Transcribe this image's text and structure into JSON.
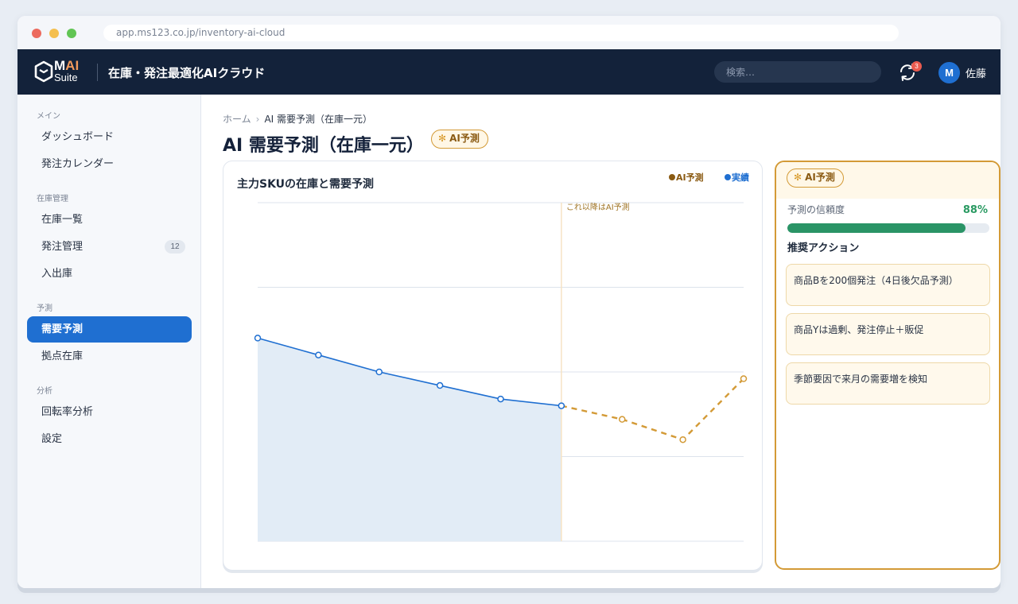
{
  "browser": {
    "url": "app.ms123.co.jp/inventory-ai-cloud"
  },
  "header": {
    "logo_ai": "AI",
    "logo_m": "M",
    "logo_suite": "Suite",
    "app_title": "在庫・発注最適化AIクラウド",
    "search_placeholder": "検索…",
    "notification_count": "3",
    "user_initial": "M",
    "user_name": "佐藤"
  },
  "sidebar": {
    "sections": [
      {
        "label": "メイン"
      },
      {
        "label": "在庫管理"
      },
      {
        "label": "予測"
      },
      {
        "label": "分析"
      }
    ],
    "items": [
      {
        "label": "ダッシュボード"
      },
      {
        "label": "発注カレンダー"
      },
      {
        "label": "在庫一覧"
      },
      {
        "label": "発注管理",
        "badge": "12"
      },
      {
        "label": "入出庫"
      },
      {
        "label": "需要予測",
        "active": true
      },
      {
        "label": "拠点在庫"
      },
      {
        "label": "回転率分析"
      },
      {
        "label": "設定"
      }
    ]
  },
  "breadcrumb": {
    "home": "ホーム",
    "separator": "›",
    "current": "AI 需要予測（在庫一元）"
  },
  "page": {
    "title": "AI 需要予測（在庫一元）",
    "ai_badge": "AI予測"
  },
  "chart_data": {
    "type": "line",
    "title": "主力SKUの在庫と需要予測",
    "x": [
      0,
      1,
      2,
      3,
      4,
      5,
      6,
      7,
      8
    ],
    "ylim": [
      0,
      100
    ],
    "grid": true,
    "legend_placement": "top-right",
    "annotation": "これ以降はAI予測",
    "forecast_start_index": 5,
    "series": [
      {
        "name": "実績",
        "color": "#1f6fd1",
        "values": [
          60,
          55,
          50,
          46,
          42,
          40,
          null,
          null,
          null
        ]
      },
      {
        "name": "AI予測",
        "color": "#d39a36",
        "values": [
          null,
          null,
          null,
          null,
          null,
          40,
          36,
          30,
          48
        ]
      }
    ]
  },
  "legend": {
    "ai": "AI予測",
    "actual": "実績"
  },
  "insight": {
    "badge": "AI予測",
    "confidence_label": "予測の信頼度",
    "confidence_value": "88%",
    "confidence_fraction": 0.88,
    "actions_title": "推奨アクション",
    "actions": [
      {
        "text": "商品Bを200個発注（4日後欠品予測）"
      },
      {
        "text": "商品Yは過剰、発注停止＋販促"
      },
      {
        "text": "季節要因で来月の需要増を検知"
      }
    ]
  },
  "colors": {
    "primary": "#1f6fd1",
    "ai_gold": "#d39a36",
    "topbar": "#13223a",
    "success": "#2a9466"
  }
}
